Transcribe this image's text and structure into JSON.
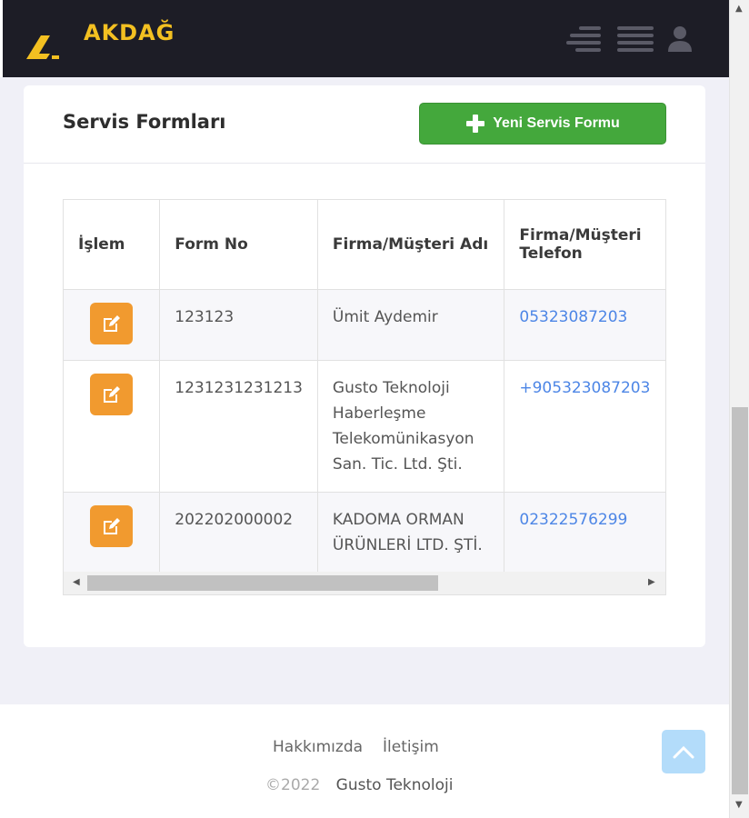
{
  "brand": {
    "name": "AKDAĞ",
    "color": "#f3c021"
  },
  "nav": {
    "icons": [
      "menu-align-icon",
      "hamburger-menu-icon",
      "user-icon"
    ]
  },
  "page": {
    "title": "Servis Formları",
    "new_button_label": "Yeni Servis Formu"
  },
  "table": {
    "headers": [
      "İşlem",
      "Form No",
      "Firma/Müşteri Adı",
      "Firma/Müşteri Telefon"
    ],
    "rows": [
      {
        "form_no": "123123",
        "name": "Ümit Aydemir",
        "phone": "05323087203"
      },
      {
        "form_no": "1231231231213",
        "name": "Gusto Teknoloji Haberleşme Telekomünikasyon San. Tic. Ltd. Şti.",
        "phone": "+905323087203"
      },
      {
        "form_no": "202202000002",
        "name": "KADOMA ORMAN ÜRÜNLERİ LTD. ŞTİ.",
        "phone": "02322576299"
      }
    ]
  },
  "footer": {
    "links": [
      "Hakkımızda",
      "İletişim"
    ],
    "copyright": "©2022",
    "company": "Gusto Teknoloji"
  },
  "colors": {
    "accent_green": "#44a83c",
    "edit_orange": "#f19a2f",
    "link_blue": "#4d86e6",
    "navbar": "#1d1d26"
  }
}
